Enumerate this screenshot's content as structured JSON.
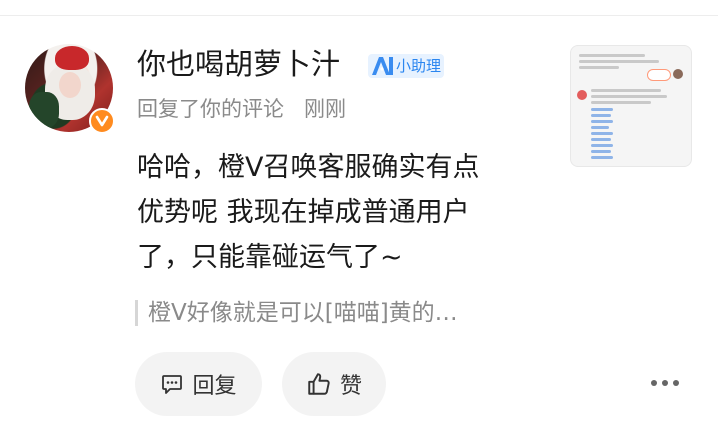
{
  "comment": {
    "username": "你也喝胡萝卜汁",
    "ai_badge_label": "小助理",
    "action_text": "回复了你的评论",
    "time": "刚刚",
    "body_lines": [
      "哈哈，橙V召唤客服确实有点",
      "优势呢 我现在掉成普通用户",
      "了，只能靠碰运气了~"
    ],
    "quoted_text": "橙V好像就是可以[喵喵]黄的…"
  },
  "actions": {
    "reply_label": "回复",
    "like_label": "赞"
  },
  "icons": {
    "verified": "v-badge-icon",
    "ai": "ai-logo-icon",
    "reply": "comment-icon",
    "like": "thumbs-up-icon",
    "more": "more-dots-icon"
  },
  "colors": {
    "verified_badge": "#ff8b1f",
    "ai_badge_bg": "#e7f2ff",
    "ai_badge_text": "#2b86f0",
    "secondary_text": "#8a8a8a",
    "button_bg": "#f3f3f3"
  }
}
